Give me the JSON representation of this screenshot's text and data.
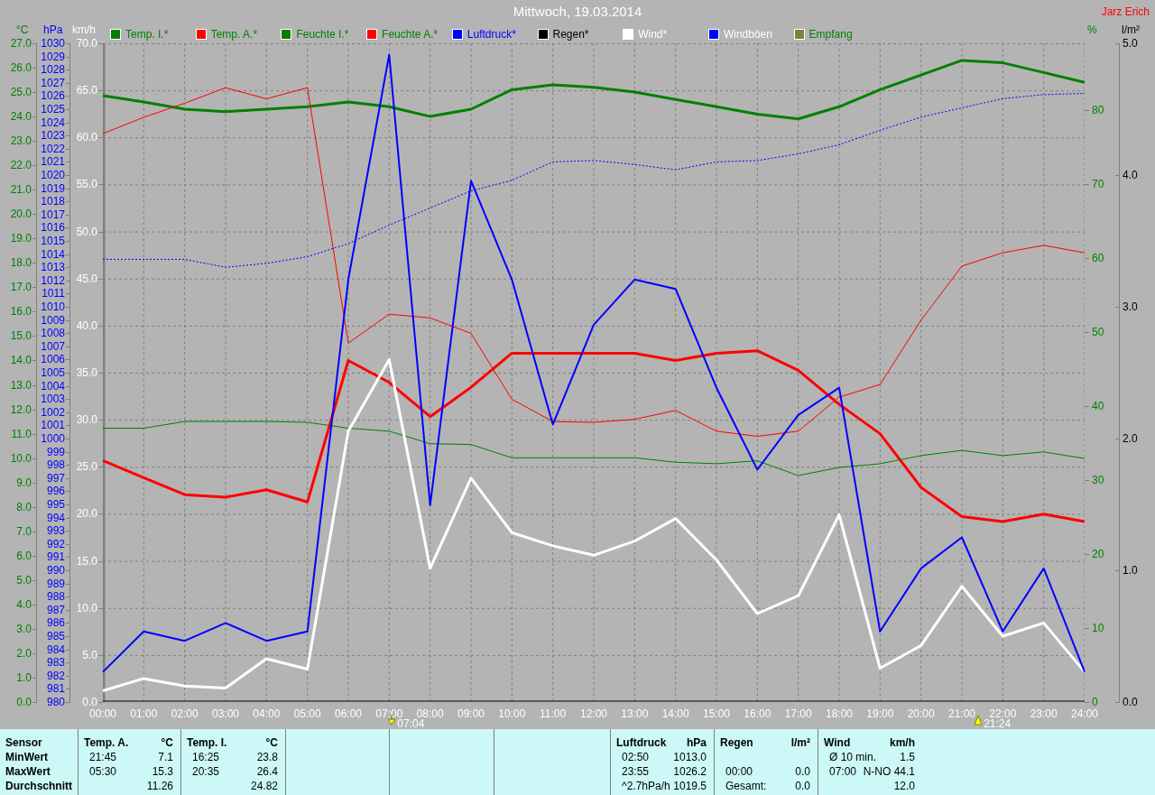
{
  "title": "Mittwoch, 19.03.2014",
  "author": "Jarz Erich",
  "charts": [
    {
      "chart_data": {
        "type": "line",
        "legend": "top",
        "ylabel": "°C",
        "x": [
          0,
          1,
          2,
          3,
          4,
          5,
          6,
          7,
          8,
          9,
          10,
          11,
          12,
          13,
          14,
          15,
          16,
          17,
          18,
          19,
          20,
          21,
          22,
          23,
          24
        ],
        "xlim": [
          0,
          24
        ],
        "xticks": [
          {
            "value": 0,
            "label": "00:00"
          },
          {
            "value": 1,
            "label": "01:00"
          },
          {
            "value": 2,
            "label": "02:00"
          },
          {
            "value": 3,
            "label": "03:00"
          },
          {
            "value": 4,
            "label": "04:00"
          },
          {
            "value": 5,
            "label": "05:00"
          },
          {
            "value": 6,
            "label": "06:00"
          },
          {
            "value": 7,
            "label": "07:00"
          },
          {
            "value": 8,
            "label": "08:00"
          },
          {
            "value": 9,
            "label": "09:00"
          },
          {
            "value": 10,
            "label": "10:00"
          },
          {
            "value": 11,
            "label": "11:00"
          },
          {
            "value": 12,
            "label": "12:00"
          },
          {
            "value": 13,
            "label": "13:00"
          },
          {
            "value": 14,
            "label": "14:00"
          },
          {
            "value": 15,
            "label": "15:00"
          },
          {
            "value": 16,
            "label": "16:00"
          },
          {
            "value": 17,
            "label": "17:00"
          },
          {
            "value": 18,
            "label": "18:00"
          },
          {
            "value": 19,
            "label": "19:00"
          },
          {
            "value": 20,
            "label": "20:00"
          },
          {
            "value": 21,
            "label": "21:00"
          },
          {
            "value": 22,
            "label": "22:00"
          },
          {
            "value": 23,
            "label": "23:00"
          },
          {
            "value": 24,
            "label": "24:00"
          }
        ],
        "ylim": [
          0,
          27
        ],
        "yticks": [
          {
            "value": 0,
            "label": "0.0"
          },
          {
            "value": 1,
            "label": "1.0"
          },
          {
            "value": 2,
            "label": "2.0"
          },
          {
            "value": 3,
            "label": "3.0"
          },
          {
            "value": 4,
            "label": "4.0"
          },
          {
            "value": 5,
            "label": "5.0"
          },
          {
            "value": 6,
            "label": "6.0"
          },
          {
            "value": 7,
            "label": "7.0"
          },
          {
            "value": 8,
            "label": "8.0"
          },
          {
            "value": 9,
            "label": "9.0"
          },
          {
            "value": 10,
            "label": "10.0"
          },
          {
            "value": 11,
            "label": "11.0"
          },
          {
            "value": 12,
            "label": "12.0"
          },
          {
            "value": 13,
            "label": "13.0"
          },
          {
            "value": 14,
            "label": "14.0"
          },
          {
            "value": 15,
            "label": "15.0"
          },
          {
            "value": 16,
            "label": "16.0"
          },
          {
            "value": 17,
            "label": "17.0"
          },
          {
            "value": 18,
            "label": "18.0"
          },
          {
            "value": 19,
            "label": "19.0"
          },
          {
            "value": 20,
            "label": "20.0"
          },
          {
            "value": 21,
            "label": "21.0"
          },
          {
            "value": 22,
            "label": "22.0"
          },
          {
            "value": 23,
            "label": "23.0"
          },
          {
            "value": 24,
            "label": "24.0"
          },
          {
            "value": 25,
            "label": "25.0"
          },
          {
            "value": 26,
            "label": "26.0"
          },
          {
            "value": 27,
            "label": "27.0"
          }
        ],
        "series": [
          {
            "name": "Temp. I.*",
            "color": "#008000",
            "values": [
              24.85,
              24.6,
              24.3,
              24.2,
              24.3,
              24.4,
              24.6,
              24.4,
              24.0,
              24.3,
              25.1,
              25.3,
              25.2,
              25.0,
              24.7,
              24.4,
              24.1,
              23.9,
              24.4,
              25.1,
              25.7,
              26.3,
              26.2,
              25.8,
              25.4
            ]
          },
          {
            "name": "Temp. A.*",
            "color": "#ff0000",
            "values": [
              9.9,
              9.2,
              8.5,
              8.4,
              8.7,
              8.2,
              14.0,
              13.1,
              11.7,
              12.9,
              14.3,
              14.3,
              14.3,
              14.3,
              14.0,
              14.3,
              14.4,
              13.6,
              12.2,
              11.0,
              8.8,
              7.6,
              7.4,
              7.7,
              7.4
            ]
          }
        ]
      }
    },
    {
      "chart_data": {
        "type": "line",
        "legend": "top",
        "ylabel": "%",
        "x": [
          0,
          1,
          2,
          3,
          4,
          5,
          6,
          7,
          8,
          9,
          10,
          11,
          12,
          13,
          14,
          15,
          16,
          17,
          18,
          19,
          20,
          21,
          22,
          23,
          24
        ],
        "xlim": [
          0,
          24
        ],
        "ylim": [
          0,
          89
        ],
        "yticks": [
          0,
          10,
          20,
          30,
          40,
          50,
          60,
          70,
          80
        ],
        "series": [
          {
            "name": "Feuchte I.*",
            "color": "#008000",
            "values": [
              37.0,
              37.0,
              37.9,
              37.9,
              37.9,
              37.8,
              37.0,
              36.6,
              34.9,
              34.8,
              33.0,
              33.0,
              33.0,
              33.0,
              32.4,
              32.2,
              32.6,
              30.6,
              31.7,
              32.2,
              33.3,
              34.0,
              33.3,
              33.8,
              32.9
            ]
          },
          {
            "name": "Feuchte A.*",
            "color": "#ff0000",
            "values": [
              76.8,
              79.0,
              80.9,
              83.0,
              81.5,
              83.0,
              48.5,
              52.4,
              51.9,
              49.8,
              40.9,
              37.9,
              37.8,
              38.2,
              39.4,
              36.6,
              35.9,
              36.6,
              41.2,
              42.9,
              51.6,
              58.9,
              60.7,
              61.7,
              60.7
            ]
          },
          {
            "name": "Empfang",
            "color": "#808040",
            "values": [
              null,
              null,
              null,
              null,
              null,
              null,
              null,
              null,
              null,
              null,
              null,
              null,
              null,
              null,
              null,
              null,
              null,
              null,
              null,
              null,
              null,
              null,
              null,
              null,
              null
            ]
          }
        ]
      }
    },
    {
      "chart_data": {
        "type": "line",
        "legend": "top",
        "ylabel": "hPa",
        "x": [
          0,
          1,
          2,
          3,
          4,
          5,
          6,
          7,
          8,
          9,
          10,
          11,
          12,
          13,
          14,
          15,
          16,
          17,
          18,
          19,
          20,
          21,
          22,
          23,
          24
        ],
        "xlim": [
          0,
          24
        ],
        "ylim": [
          980,
          1030
        ],
        "yticks": [
          980,
          981,
          982,
          983,
          984,
          985,
          986,
          987,
          988,
          989,
          990,
          991,
          992,
          993,
          994,
          995,
          996,
          997,
          998,
          999,
          1000,
          1001,
          1002,
          1003,
          1004,
          1005,
          1006,
          1007,
          1008,
          1009,
          1010,
          1011,
          1012,
          1013,
          1014,
          1015,
          1016,
          1017,
          1018,
          1019,
          1020,
          1021,
          1022,
          1023,
          1024,
          1025,
          1026,
          1027,
          1028,
          1029,
          1030
        ],
        "series": [
          {
            "name": "Luftdruck*",
            "color": "#0000ff",
            "line_style": "dashed",
            "values": [
              1013.6,
              1013.6,
              1013.6,
              1013.0,
              1013.3,
              1013.8,
              1014.8,
              1016.2,
              1017.5,
              1018.8,
              1019.6,
              1021.0,
              1021.1,
              1020.8,
              1020.4,
              1021.0,
              1021.1,
              1021.6,
              1022.3,
              1023.4,
              1024.4,
              1025.1,
              1025.8,
              1026.1,
              1026.2
            ]
          }
        ]
      }
    },
    {
      "chart_data": {
        "type": "line",
        "legend": "top",
        "ylabel": "l/m²",
        "x": [
          0,
          1,
          2,
          3,
          4,
          5,
          6,
          7,
          8,
          9,
          10,
          11,
          12,
          13,
          14,
          15,
          16,
          17,
          18,
          19,
          20,
          21,
          22,
          23,
          24
        ],
        "xlim": [
          0,
          24
        ],
        "ylim": [
          0,
          5
        ],
        "yticks": [
          {
            "value": 0,
            "label": "0.0"
          },
          {
            "value": 1,
            "label": "1.0"
          },
          {
            "value": 2,
            "label": "2.0"
          },
          {
            "value": 3,
            "label": "3.0"
          },
          {
            "value": 4,
            "label": "4.0"
          },
          {
            "value": 5,
            "label": "5.0"
          }
        ],
        "series": [
          {
            "name": "Regen*",
            "color": "#000000",
            "values": [
              0,
              0,
              0,
              0,
              0,
              0,
              0,
              0,
              0,
              0,
              0,
              0,
              0,
              0,
              0,
              0,
              0,
              0,
              0,
              0,
              0,
              0,
              0,
              0,
              0
            ]
          }
        ]
      }
    },
    {
      "chart_data": {
        "type": "line",
        "legend": "top",
        "ylabel": "km/h",
        "x": [
          0,
          1,
          2,
          3,
          4,
          5,
          6,
          7,
          8,
          9,
          10,
          11,
          12,
          13,
          14,
          15,
          16,
          17,
          18,
          19,
          20,
          21,
          22,
          23,
          24
        ],
        "xlim": [
          0,
          24
        ],
        "ylim": [
          0,
          70
        ],
        "yticks": [
          {
            "value": 0,
            "label": "0.0"
          },
          {
            "value": 5,
            "label": "5.0"
          },
          {
            "value": 10,
            "label": "10.0"
          },
          {
            "value": 15,
            "label": "15.0"
          },
          {
            "value": 20,
            "label": "20.0"
          },
          {
            "value": 25,
            "label": "25.0"
          },
          {
            "value": 30,
            "label": "30.0"
          },
          {
            "value": 35,
            "label": "35.0"
          },
          {
            "value": 40,
            "label": "40.0"
          },
          {
            "value": 45,
            "label": "45.0"
          },
          {
            "value": 50,
            "label": "50.0"
          },
          {
            "value": 55,
            "label": "55.0"
          },
          {
            "value": 60,
            "label": "60.0"
          },
          {
            "value": 65,
            "label": "65.0"
          },
          {
            "value": 70,
            "label": "70.0"
          }
        ],
        "series": [
          {
            "name": "Wind*",
            "color": "#ffffff",
            "values": [
              1.2,
              2.5,
              1.7,
              1.5,
              4.6,
              3.5,
              28.8,
              36.4,
              14.2,
              23.8,
              18.0,
              16.6,
              15.6,
              17.1,
              19.5,
              15.1,
              9.4,
              11.3,
              19.9,
              3.6,
              6.0,
              12.3,
              7.0,
              8.4,
              3.2
            ]
          },
          {
            "name": "Windböen",
            "color": "#0000ff",
            "values": [
              3.2,
              7.5,
              6.5,
              8.4,
              6.5,
              7.5,
              44.9,
              68.8,
              20.9,
              55.4,
              44.9,
              29.5,
              40.1,
              44.9,
              43.9,
              33.4,
              24.7,
              30.5,
              33.4,
              7.5,
              14.2,
              17.5,
              7.5,
              14.2,
              3.2
            ]
          }
        ]
      }
    }
  ],
  "time_markers": [
    {
      "time": "07:04",
      "kind": "down"
    },
    {
      "time": "21:24",
      "kind": "up"
    }
  ],
  "summary": {
    "row_labels": [
      "Sensor",
      "MinWert",
      "MaxWert",
      "Durchschnitt"
    ],
    "sensors": [
      {
        "name": "Temp. A.",
        "unit": "°C",
        "rows": [
          {
            "time": "21:45",
            "value": "7.1"
          },
          {
            "time": "05:30",
            "value": "15.3"
          },
          {
            "value": "11.26"
          }
        ]
      },
      {
        "name": "Temp. I.",
        "unit": "°C",
        "rows": [
          {
            "time": "16:25",
            "value": "23.8"
          },
          {
            "time": "20:35",
            "value": "26.4"
          },
          {
            "value": "24.82"
          }
        ]
      },
      {
        "name": "Luftdruck",
        "unit": "hPa",
        "rows": [
          {
            "time": "02:50",
            "value": "1013.0"
          },
          {
            "time": "23:55",
            "value": "1026.2"
          },
          {
            "time": "^2.7hPa/h",
            "value": "1019.5"
          }
        ]
      },
      {
        "name": "Regen",
        "unit": "l/m²",
        "rows": [
          {},
          {
            "time": "00:00",
            "value": "0.0"
          },
          {
            "time": "Gesamt:",
            "value": "0.0"
          }
        ]
      },
      {
        "name": "Wind",
        "unit": "km/h",
        "rows": [
          {
            "time": "Ø 10 min.",
            "value": "1.5"
          },
          {
            "time": "07:00",
            "value": "N-NO 44.1"
          },
          {
            "value": "12.0"
          }
        ]
      }
    ]
  }
}
